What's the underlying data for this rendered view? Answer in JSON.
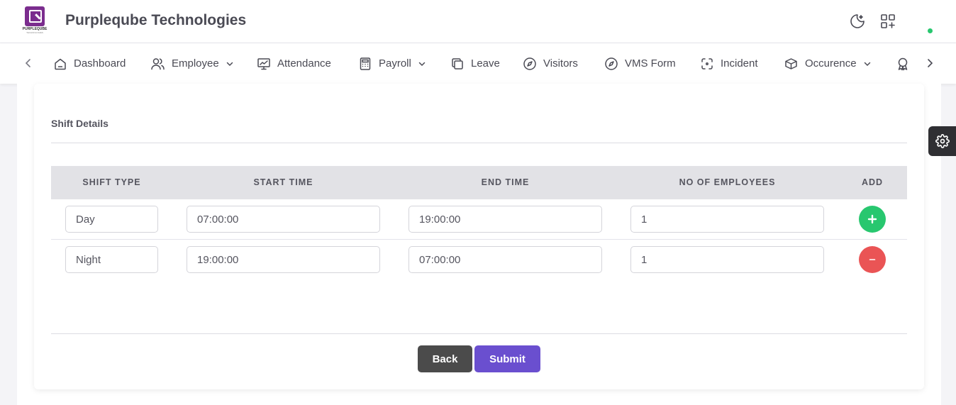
{
  "header": {
    "logo_text": "PURPLEQUBE",
    "logo_subtext": "TECHNOLOGIES",
    "brand": "Purpleqube Technologies",
    "icons": [
      "moon-icon",
      "apps-add-icon"
    ],
    "status_color": "#28c76f"
  },
  "nav": {
    "items": [
      {
        "label": "Dashboard",
        "icon": "home-icon"
      },
      {
        "label": "Employee",
        "icon": "users-icon",
        "dropdown": true
      },
      {
        "label": "Attendance",
        "icon": "presentation-chart-icon"
      },
      {
        "label": "Payroll",
        "icon": "calculator-icon",
        "dropdown": true
      },
      {
        "label": "Leave",
        "icon": "copy-icon"
      },
      {
        "label": "Visitors",
        "icon": "compass-icon"
      },
      {
        "label": "VMS Form",
        "icon": "compass-icon"
      },
      {
        "label": "Incident",
        "icon": "focus-icon"
      },
      {
        "label": "Occurence",
        "icon": "box-icon",
        "dropdown": true
      }
    ]
  },
  "section": {
    "title": "Shift Details"
  },
  "table": {
    "headers": [
      "SHIFT TYPE",
      "START TIME",
      "END TIME",
      "NO OF EMPLOYEES",
      "ADD"
    ],
    "rows": [
      {
        "shift_type": "Day",
        "start_time": "07:00:00",
        "end_time": "19:00:00",
        "employees": "1",
        "action": "add"
      },
      {
        "shift_type": "Night",
        "start_time": "19:00:00",
        "end_time": "07:00:00",
        "employees": "1",
        "action": "remove"
      }
    ]
  },
  "actions": {
    "back": "Back",
    "submit": "Submit"
  },
  "colors": {
    "brand": "#7b2d8e",
    "add": "#28c76f",
    "remove": "#ea5455",
    "submit": "#6a4fcf",
    "back": "#4b4b4b"
  }
}
